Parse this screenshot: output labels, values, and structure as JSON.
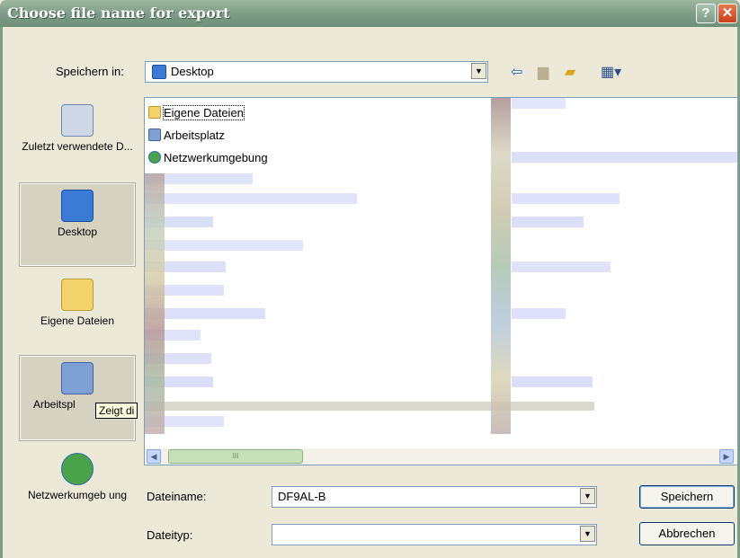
{
  "window": {
    "title": "Choose file name for export"
  },
  "savein": {
    "label": "Speichern in:",
    "value": "Desktop"
  },
  "toolbar": {
    "back_icon": "back-arrow-icon",
    "up_icon": "up-folder-icon",
    "new_icon": "new-folder-icon",
    "views_icon": "views-menu-icon"
  },
  "places": [
    {
      "label": "Zuletzt verwendete D..."
    },
    {
      "label": "Desktop"
    },
    {
      "label": "Eigene Dateien"
    },
    {
      "label": "Arbeitspl"
    },
    {
      "label": "Netzwerkumgeb ung"
    }
  ],
  "files": [
    {
      "name": "Eigene Dateien"
    },
    {
      "name": "Arbeitsplatz"
    },
    {
      "name": "Netzwerkumgebung"
    }
  ],
  "tooltip": "Zeigt di",
  "filename": {
    "label": "Dateiname:",
    "value": "DF9AL-B"
  },
  "filetype": {
    "label": "Dateityp:",
    "value": ""
  },
  "buttons": {
    "save": "Speichern",
    "cancel": "Abbrechen"
  },
  "scroll_thumb": "III",
  "colors": {
    "title_bar": "#7f9d86",
    "dialog_bg": "#ece9d8",
    "close": "#c9401c"
  }
}
